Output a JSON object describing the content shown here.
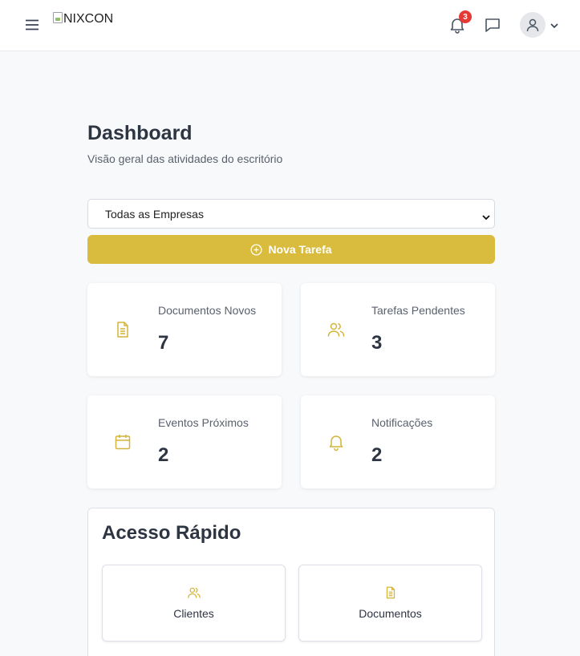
{
  "header": {
    "logo_alt": "NIXCON",
    "notification_count": "3"
  },
  "page": {
    "title": "Dashboard",
    "subtitle": "Visão geral das atividades do escritório"
  },
  "company_filter": {
    "selected": "Todas as Empresas"
  },
  "new_task_button": {
    "label": "Nova Tarefa"
  },
  "stats": [
    {
      "label": "Documentos Novos",
      "value": "7",
      "icon": "document-icon"
    },
    {
      "label": "Tarefas Pendentes",
      "value": "3",
      "icon": "users-icon"
    },
    {
      "label": "Eventos Próximos",
      "value": "2",
      "icon": "calendar-icon"
    },
    {
      "label": "Notificações",
      "value": "2",
      "icon": "bell-icon"
    }
  ],
  "quick_access": {
    "title": "Acesso Rápido",
    "items": [
      {
        "label": "Clientes",
        "icon": "users-icon"
      },
      {
        "label": "Documentos",
        "icon": "document-icon"
      }
    ]
  },
  "colors": {
    "accent": "#d9bb3e",
    "badge": "#e53935"
  }
}
